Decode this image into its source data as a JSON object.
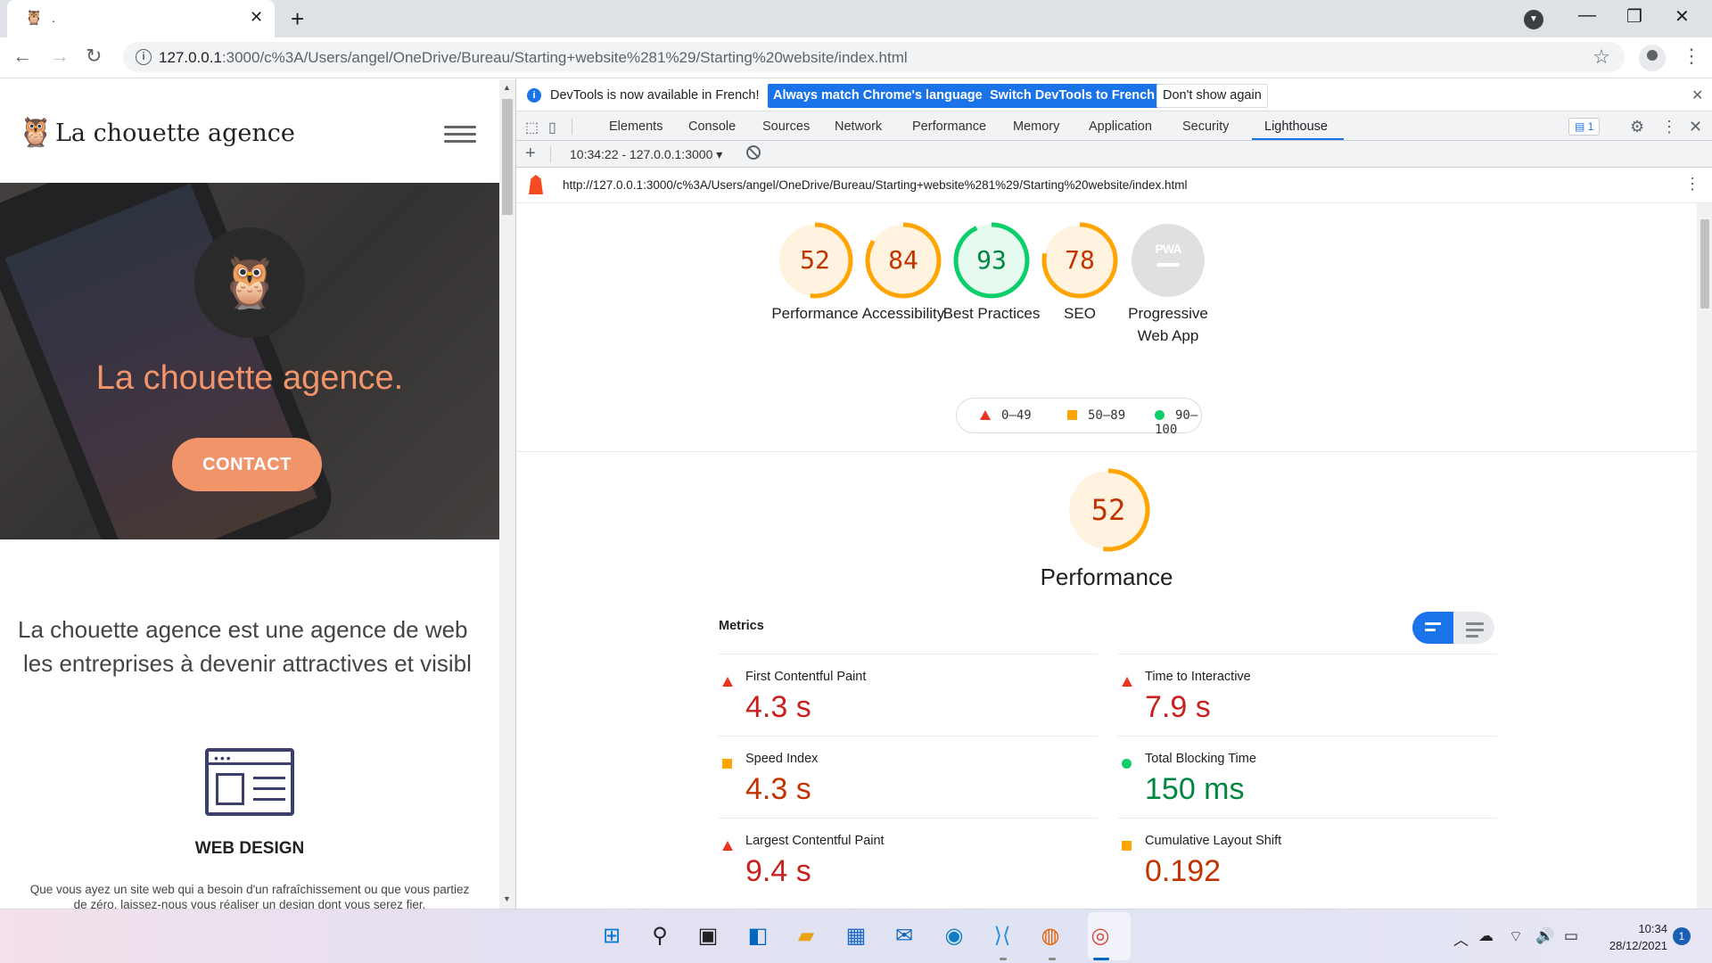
{
  "browser": {
    "tab_title": ".",
    "url_host": "127.0.0.1",
    "url_rest": ":3000/c%3A/Users/angel/OneDrive/Bureau/Starting+website%281%29/Starting%20website/index.html"
  },
  "site": {
    "logo_text": "La chouette agence",
    "hero_title": "La chouette agence.",
    "cta_label": "CONTACT",
    "intro_line1": "La chouette agence est une agence de web",
    "intro_line2": "les entreprises à devenir attractives et visibl",
    "section_title": "WEB DESIGN",
    "section_text": "Que vous ayez un site web qui a besoin d'un rafraîchissement ou que vous partiez de zéro, laissez-nous vous réaliser un design dont vous serez fier."
  },
  "devtools": {
    "infobar": {
      "message": "DevTools is now available in French!",
      "btn_match": "Always match Chrome's language",
      "btn_switch": "Switch DevTools to French",
      "btn_dismiss": "Don't show again"
    },
    "tabs": [
      "Elements",
      "Console",
      "Sources",
      "Network",
      "Performance",
      "Memory",
      "Application",
      "Security",
      "Lighthouse"
    ],
    "active_tab": "Lighthouse",
    "issues_count": "1",
    "report_select": "10:34:22 - 127.0.0.1:3000",
    "report_url": "http://127.0.0.1:3000/c%3A/Users/angel/OneDrive/Bureau/Starting+website%281%29/Starting%20website/index.html"
  },
  "lighthouse": {
    "categories": [
      {
        "label": "Performance",
        "score": 52,
        "color": "#ffa400",
        "text_color": "#c33300"
      },
      {
        "label": "Accessibility",
        "score": 84,
        "color": "#ffa400",
        "text_color": "#c33300"
      },
      {
        "label": "Best Practices",
        "score": 93,
        "color": "#0cce6b",
        "text_color": "#018642"
      },
      {
        "label": "SEO",
        "score": 78,
        "color": "#ffa400",
        "text_color": "#c33300"
      }
    ],
    "pwa": {
      "label": "Progressive Web App",
      "badge": "PWA"
    },
    "legend": {
      "fail": "0–49",
      "average": "50–89",
      "pass": "90–100"
    },
    "section_score": 52,
    "section_title": "Performance",
    "metrics_title": "Metrics",
    "metrics": [
      {
        "name": "First Contentful Paint",
        "value": "4.3 s",
        "rating": "fail"
      },
      {
        "name": "Time to Interactive",
        "value": "7.9 s",
        "rating": "fail"
      },
      {
        "name": "Speed Index",
        "value": "4.3 s",
        "rating": "average"
      },
      {
        "name": "Total Blocking Time",
        "value": "150 ms",
        "rating": "pass"
      },
      {
        "name": "Largest Contentful Paint",
        "value": "9.4 s",
        "rating": "fail"
      },
      {
        "name": "Cumulative Layout Shift",
        "value": "0.192",
        "rating": "average"
      }
    ]
  },
  "taskbar": {
    "time": "10:34",
    "date": "28/12/2021",
    "notifications": "1"
  }
}
